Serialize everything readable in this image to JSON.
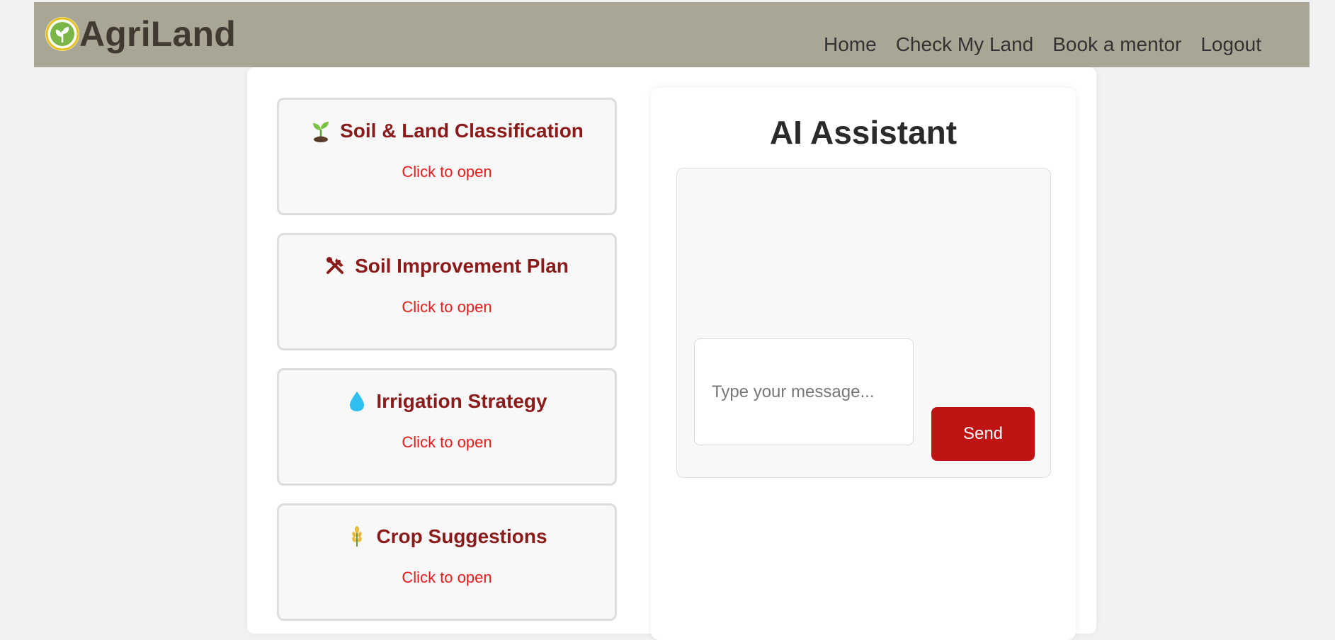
{
  "header": {
    "brand": "AgriLand",
    "nav": [
      "Home",
      "Check My Land",
      "Book a mentor",
      "Logout"
    ]
  },
  "cards": [
    {
      "title": "Soil & Land Classification",
      "subtitle": "Click to open",
      "icon": "seedling-icon"
    },
    {
      "title": "Soil Improvement Plan",
      "subtitle": "Click to open",
      "icon": "hammer-wrench-icon"
    },
    {
      "title": "Irrigation Strategy",
      "subtitle": "Click to open",
      "icon": "water-drop-icon"
    },
    {
      "title": "Crop Suggestions",
      "subtitle": "Click to open",
      "icon": "wheat-icon"
    }
  ],
  "assistant": {
    "title": "AI Assistant",
    "input_placeholder": "Type your message...",
    "send_label": "Send"
  },
  "colors": {
    "header_bg": "#aaa696",
    "card_title": "#8b1a1a",
    "card_sub": "#e81b1b",
    "send_button": "#c01313"
  }
}
